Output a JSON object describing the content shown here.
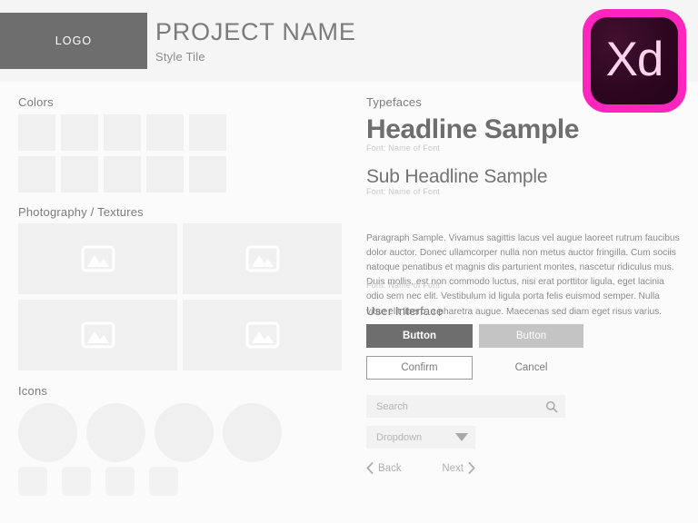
{
  "header": {
    "logo_label": "LOGO",
    "project_name": "PROJECT NAME",
    "subtitle": "Style Tile",
    "app_badge": "Xd",
    "app_badge_border_color": "#ff26be",
    "app_badge_fill_color": "#2d0620",
    "app_badge_text_color": "#fbd4ec",
    "logo_box_color": "#6e6e6e"
  },
  "sections": {
    "colors": "Colors",
    "photography": "Photography / Textures",
    "icons": "Icons",
    "typefaces": "Typefaces",
    "user_interface": "User Interface"
  },
  "colors_swatches": {
    "swatch_color": "#f0f0f0",
    "rows": [
      [
        "swatch-1",
        "swatch-2",
        "swatch-3",
        "swatch-4",
        "swatch-5"
      ],
      [
        "swatch-6",
        "swatch-7",
        "swatch-8",
        "swatch-9",
        "swatch-10"
      ]
    ]
  },
  "photography": {
    "placeholder_color": "#f0f0f0",
    "icon_name": "image-placeholder-icon",
    "cells": [
      "photo-1",
      "photo-2",
      "photo-3",
      "photo-4"
    ]
  },
  "icons_section": {
    "shape_color": "#f0f0f0",
    "circles": [
      "circle-1",
      "circle-2",
      "circle-3",
      "circle-4"
    ],
    "squares": [
      "square-1",
      "square-2",
      "square-3",
      "square-4"
    ]
  },
  "typography": {
    "headline": "Headline Sample",
    "headline_font_note": "Font: Name of Font",
    "subheadline": "Sub Headline Sample",
    "subheadline_font_note": "Font: Name of Font",
    "paragraph": "Paragraph Sample. Vivamus sagittis lacus vel augue laoreet rutrum faucibus dolor auctor. Donec ullamcorper nulla non metus auctor fringilla. Cum sociis natoque penatibus et magnis dis parturient montes, nascetur ridiculus mus. Duis mollis, est non commodo luctus, nisi erat porttitor ligula, eget lacinia odio sem nec elit. Vestibulum id ligula porta felis euismod semper. Nulla vitae elit libero, a pharetra augue. Maecenas sed diam eget risus varius.",
    "paragraph_font_note": "Font: Name of Font"
  },
  "ui": {
    "button_primary": "Button",
    "button_secondary": "Button",
    "button_confirm": "Confirm",
    "button_cancel": "Cancel",
    "search_placeholder": "Search",
    "dropdown_value": "Dropdown",
    "back_label": "Back",
    "next_label": "Next",
    "primary_button_color": "#6e6e6e",
    "secondary_button_color": "#c4c4c4",
    "field_background_color": "#f2f2f2"
  }
}
